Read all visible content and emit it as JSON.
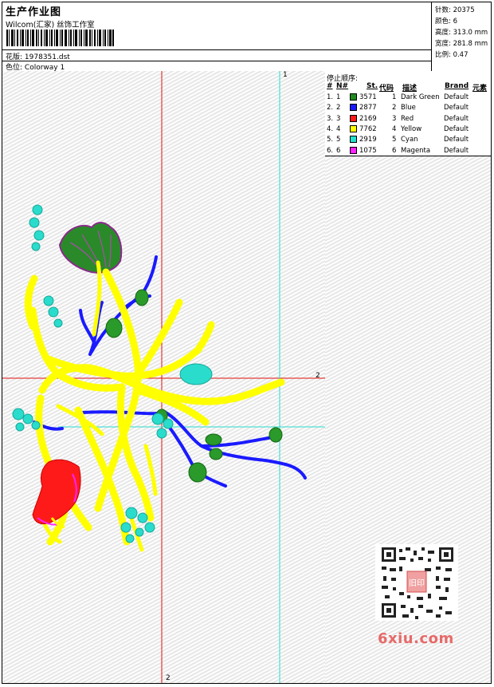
{
  "header": {
    "title": "生产作业图",
    "company": "Wilcom(汇家) 丝饰工作室",
    "pattern_label": "花版:",
    "pattern_value": "1978351.dst",
    "colorway_label": "色位:",
    "colorway_value": "Colorway 1"
  },
  "stats": {
    "stitches": "针数: 20375",
    "colors": "颜色: 6",
    "height": "高度: 313.0 mm",
    "width": "宽度: 281.8 mm",
    "scale": "比例: 0.47"
  },
  "stop_sequence": {
    "label": "停止顺序:",
    "headers": {
      "hash": "#",
      "no": "N#",
      "st": "St.",
      "code": "代码",
      "desc": "描述",
      "brand": "Brand",
      "element": "元素"
    },
    "rows": [
      {
        "idx": "1.",
        "no": "1",
        "color": "#1f8a1f",
        "st": "3571",
        "code": "1",
        "desc": "Dark Green",
        "brand": "Default"
      },
      {
        "idx": "2.",
        "no": "2",
        "color": "#1a1aff",
        "st": "2877",
        "code": "2",
        "desc": "Blue",
        "brand": "Default"
      },
      {
        "idx": "3.",
        "no": "3",
        "color": "#ff1a1a",
        "st": "2169",
        "code": "3",
        "desc": "Red",
        "brand": "Default"
      },
      {
        "idx": "4.",
        "no": "4",
        "color": "#ffff00",
        "st": "7762",
        "code": "4",
        "desc": "Yellow",
        "brand": "Default"
      },
      {
        "idx": "5.",
        "no": "5",
        "color": "#22e0cc",
        "st": "2919",
        "code": "5",
        "desc": "Cyan",
        "brand": "Default"
      },
      {
        "idx": "6.",
        "no": "6",
        "color": "#ff22ff",
        "st": "1075",
        "code": "6",
        "desc": "Magenta",
        "brand": "Default"
      }
    ]
  },
  "guides": {
    "top_label": "1",
    "right_label": "2",
    "bottom_label": "2"
  },
  "watermark": {
    "text": "6xiu.com",
    "stamp": "旧印"
  }
}
